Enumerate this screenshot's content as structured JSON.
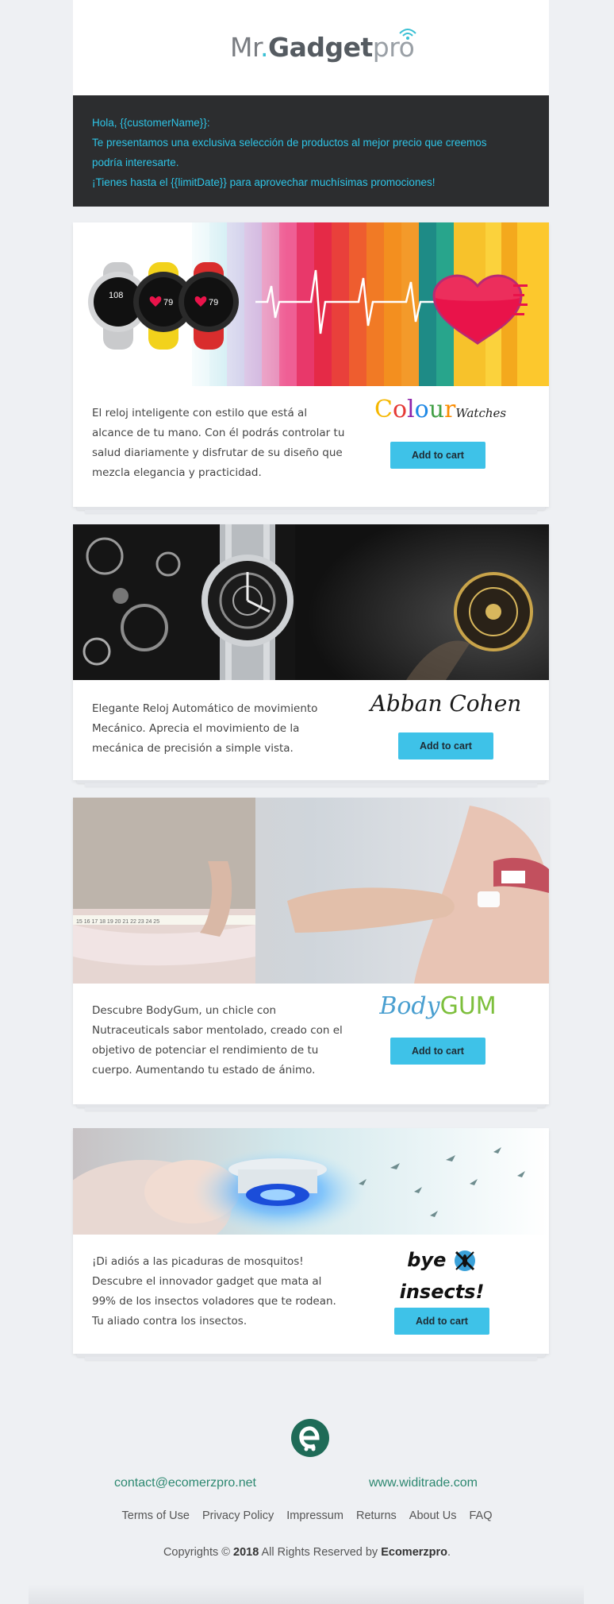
{
  "header": {
    "logo_mr": "Mr",
    "logo_dot": ".",
    "logo_gadget": "Gadget",
    "logo_pro": "pro"
  },
  "intro": {
    "line1": "Hola, {{customerName}}:",
    "line2": "Te presentamos una exclusiva selección de productos al mejor precio que creemos",
    "line3": "podría interesarte.",
    "line4": "¡Tienes hasta el {{limitDate}} para aprovechar muchísimas promociones!"
  },
  "products": [
    {
      "brand": "Colour Watches",
      "description": "El reloj inteligente con estilo que está al alcance de tu mano. Con él podrás controlar tu salud diariamente y disfrutar de su diseño que mezcla elegancia y practicidad.",
      "cta": "Add to cart",
      "watch_readouts": [
        "108",
        "79",
        "79"
      ]
    },
    {
      "brand": "Abban Cohen",
      "description": "Elegante Reloj Automático de movimiento Mecánico. Aprecia el movimiento de la mecánica de precisión a simple vista.",
      "cta": "Add to cart"
    },
    {
      "brand": "BodyGUM",
      "description": "Descubre BodyGum, un chicle con Nutraceuticals sabor mentolado, creado con el objetivo de potenciar el rendimiento de tu cuerpo. Aumentando tu estado de ánimo.",
      "cta": "Add to cart",
      "tape_numbers": "15 16 17 18 19 20 21 22 23 24 25"
    },
    {
      "brand_a": "bye",
      "brand_b": "insects!",
      "description": "¡Di adiós a las picaduras de mosquitos! Descubre el innovador gadget que mata al 99% de los insectos voladores que te rodean. Tu aliado contra los insectos.",
      "cta": "Add to cart"
    }
  ],
  "footer": {
    "email": "contact@ecomerzpro.net",
    "website": "www.widitrade.com",
    "links": [
      "Terms of Use",
      "Privacy Policy",
      "Impressum",
      "Returns",
      "About Us",
      "FAQ"
    ],
    "copy_pre": "Copyrights © ",
    "copy_year": "2018",
    "copy_mid": " All Rights Reserved by ",
    "copy_company": "Ecomerzpro",
    "copy_end": "."
  },
  "colors": {
    "accent": "#3ec2e8",
    "intro_bg": "#2c2d2f",
    "intro_text": "#2ec4e6",
    "footer_link": "#2c8870"
  }
}
